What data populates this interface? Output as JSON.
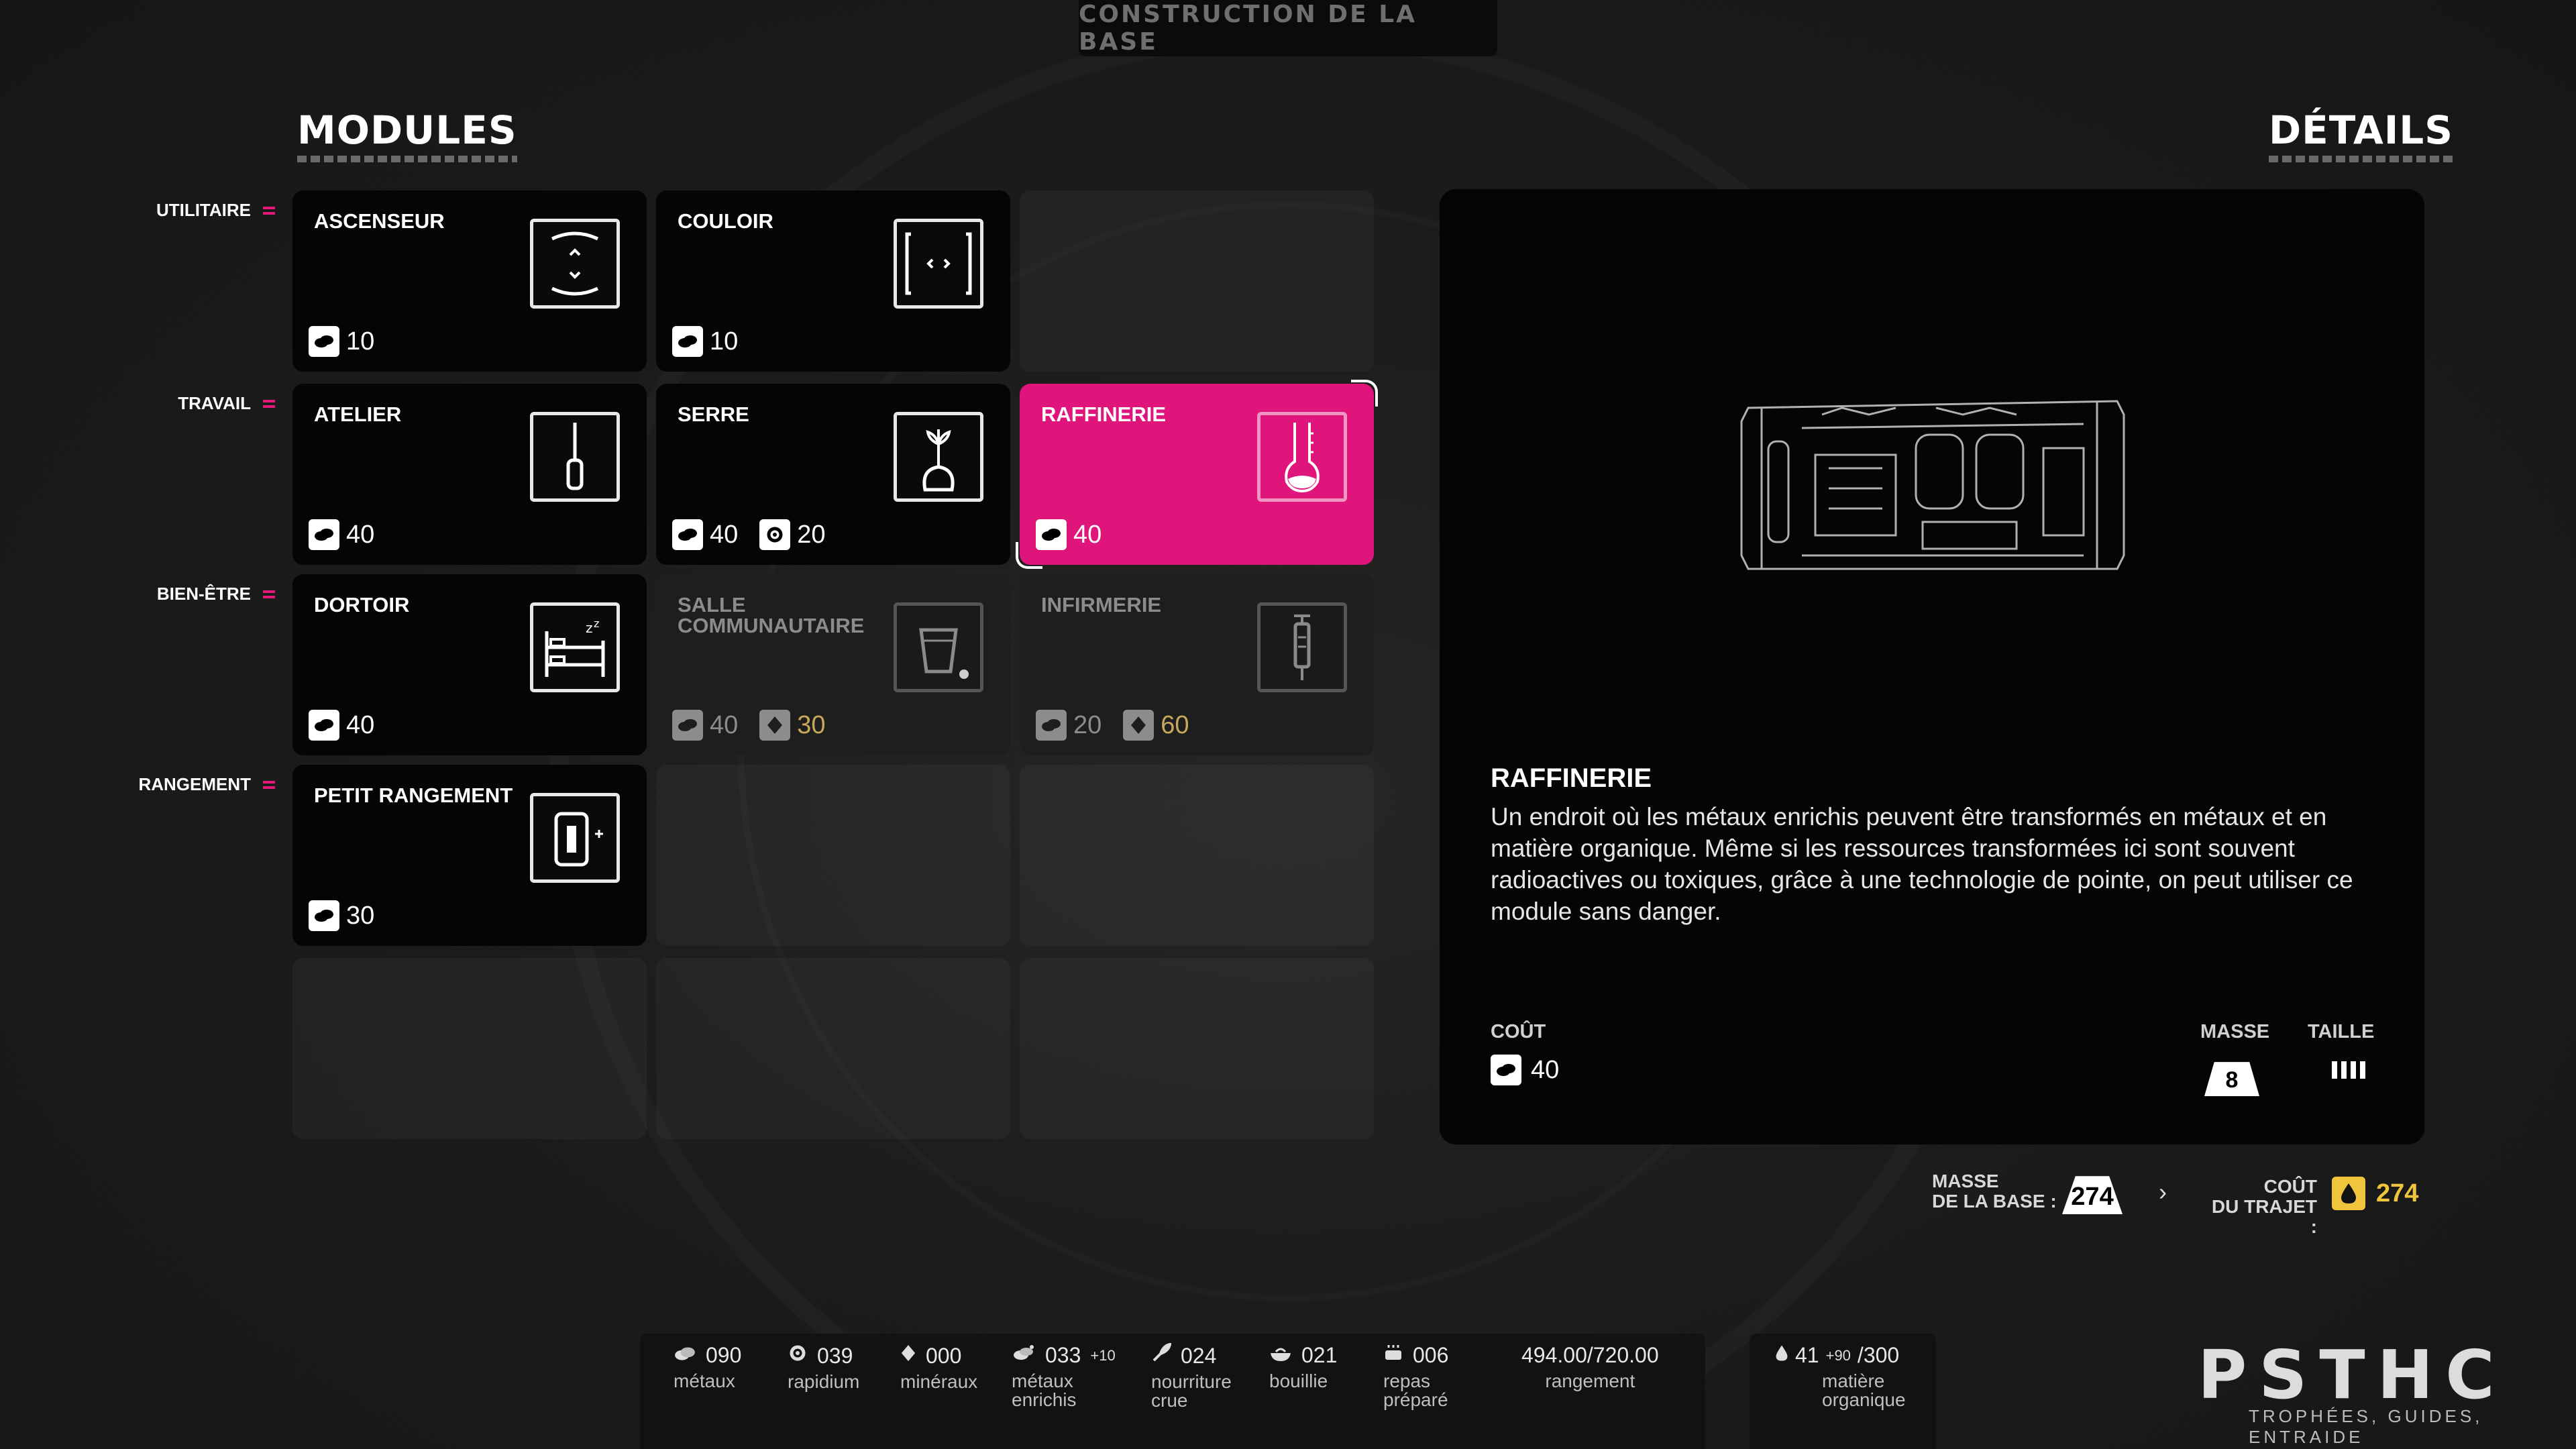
{
  "header": {
    "title": "CONSTRUCTION DE LA BASE"
  },
  "sections": {
    "modules": "MODULES",
    "details": "DÉTAILS"
  },
  "categories": {
    "utility": "UTILITAIRE",
    "work": "TRAVAIL",
    "wellbeing": "BIEN-ÊTRE",
    "storage": "RANGEMENT"
  },
  "modules": {
    "ascenseur": {
      "name": "ASCENSEUR",
      "cost": "10"
    },
    "couloir": {
      "name": "COULOIR",
      "cost": "10"
    },
    "atelier": {
      "name": "ATELIER",
      "cost": "40"
    },
    "serre": {
      "name": "SERRE",
      "cost": "40",
      "cost2": "20"
    },
    "raffinerie": {
      "name": "RAFFINERIE",
      "cost": "40"
    },
    "dortoir": {
      "name": "DORTOIR",
      "cost": "40"
    },
    "salle": {
      "name": "SALLE COMMUNAUTAIRE",
      "cost": "40",
      "cost2": "30"
    },
    "infirmerie": {
      "name": "INFIRMERIE",
      "cost": "20",
      "cost2": "60"
    },
    "petit_rangement": {
      "name": "PETIT RANGEMENT",
      "cost": "30"
    }
  },
  "details": {
    "name": "RAFFINERIE",
    "description": "Un endroit où les métaux enrichis peuvent être transformés en métaux et en matière organique. Même si les ressources transformées ici sont souvent radioactives ou toxiques, grâce à une technologie de pointe, on peut utiliser ce module sans danger.",
    "cost_label": "COÛT",
    "cost_value": "40",
    "mass_label": "MASSE",
    "mass_value": "8",
    "size_label": "TAILLE",
    "size_value": 4
  },
  "base_stats": {
    "mass_label_1": "MASSE",
    "mass_label_2": "DE LA BASE :",
    "mass_value": "274",
    "trip_label_1": "COÛT",
    "trip_label_2": "DU TRAJET :",
    "trip_value": "274"
  },
  "resources": {
    "metaux": {
      "value": "090",
      "label": "métaux"
    },
    "rapidium": {
      "value": "039",
      "label": "rapidium"
    },
    "mineraux": {
      "value": "000",
      "label": "minéraux"
    },
    "metaux_enrichis": {
      "value": "033",
      "bonus": "+10",
      "label_1": "métaux",
      "label_2": "enrichis"
    },
    "nourriture": {
      "value": "024",
      "label_1": "nourriture",
      "label_2": "crue"
    },
    "bouillie": {
      "value": "021",
      "label": "bouillie"
    },
    "repas": {
      "value": "006",
      "label_1": "repas",
      "label_2": "préparé"
    },
    "rangement": {
      "value": "494.00/720.00",
      "label": "rangement"
    },
    "matiere": {
      "value": "41",
      "bonus": "+90",
      "max": "/300",
      "label_1": "matière",
      "label_2": "organique"
    }
  },
  "logo": {
    "text": "PSTHC",
    "tagline": "TROPHÉES, GUIDES, ENTRAIDE"
  },
  "colors": {
    "accent": "#e0157b",
    "gold": "#c9a85d",
    "trip": "#f0c43c"
  }
}
